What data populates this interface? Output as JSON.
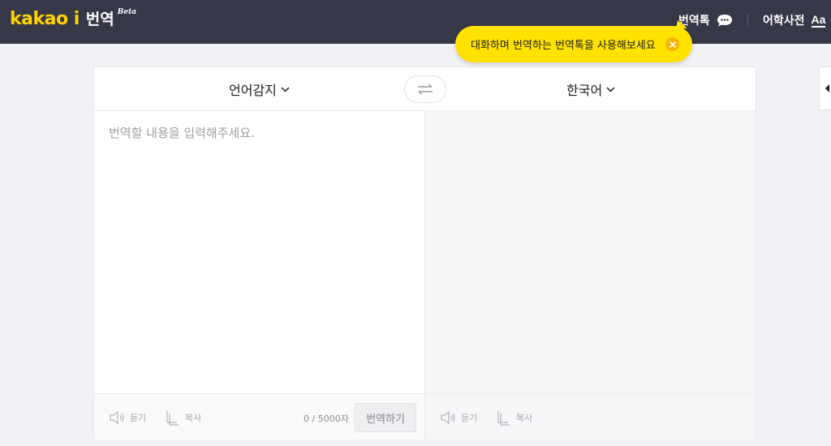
{
  "header": {
    "logo_brand": "kakao i",
    "logo_service": "번역",
    "logo_badge": "Beta",
    "talk_label": "번역톡",
    "talk_icon": "speech-bubble-icon",
    "dictionary_label": "어학사전",
    "dictionary_icon_text": "Aa",
    "background_color": "#363747",
    "brand_color": "#ffd200"
  },
  "tooltip": {
    "text": "대화하며 번역하는 번역톡을 사용해보세요",
    "close_icon": "close-icon",
    "color": "#ffe200"
  },
  "translator": {
    "source_language": "언어감지",
    "target_language": "한국어",
    "swap_icon": "swap-arrows-icon",
    "source_placeholder": "번역할 내용을 입력해주세요.",
    "source_value": "",
    "source_tools": {
      "listen_label": "듣기",
      "copy_label": "복사"
    },
    "char_count": "0 / 5000자",
    "translate_button": "번역하기",
    "target_tools": {
      "listen_label": "듣기",
      "copy_label": "복사"
    }
  }
}
